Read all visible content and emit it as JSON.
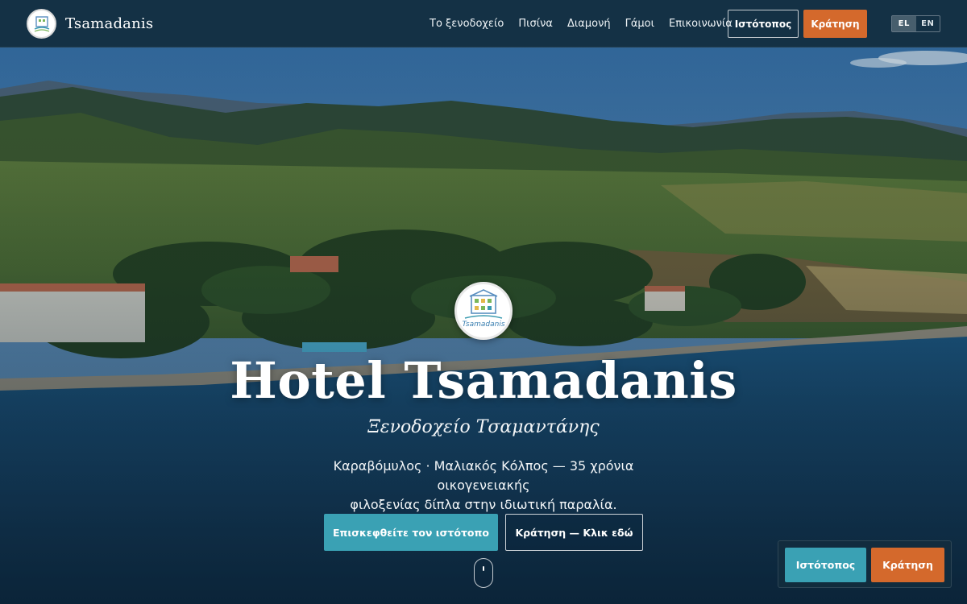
{
  "header": {
    "brand_name": "Tsamadanis",
    "nav": [
      {
        "label": "Το ξενοδοχείο"
      },
      {
        "label": "Πισίνα"
      },
      {
        "label": "Διαμονή"
      },
      {
        "label": "Γάμοι"
      },
      {
        "label": "Επικοινωνία"
      }
    ],
    "site_button": "Ιστότοπος",
    "book_button": "Κράτηση",
    "languages": [
      "EL",
      "EN"
    ],
    "active_language": "EL"
  },
  "hero": {
    "logo_text": "Tsamadanis",
    "title": "Hotel Tsamadanis",
    "subtitle": "Ξενοδοχείο Τσαμαντάνης",
    "description_line1": "Καραβόμυλος · Μαλιακός Κόλπος — 35 χρόνια οικογενειακής",
    "description_line2": "φιλοξενίας δίπλα στην ιδιωτική παραλία.",
    "visit_button": "Επισκεφθείτε τον ιστότοπο",
    "book_button": "Κράτηση — Κλικ εδώ"
  },
  "sticky_bar": {
    "site_button": "Ιστότοπος",
    "book_button": "Κράτηση"
  },
  "colors": {
    "header_bg": "#122d3e",
    "accent_teal": "#3aa1b4",
    "accent_orange": "#d4692c"
  },
  "icons": {
    "scroll": "mouse-scroll-icon",
    "logo": "hotel-logo-icon"
  }
}
